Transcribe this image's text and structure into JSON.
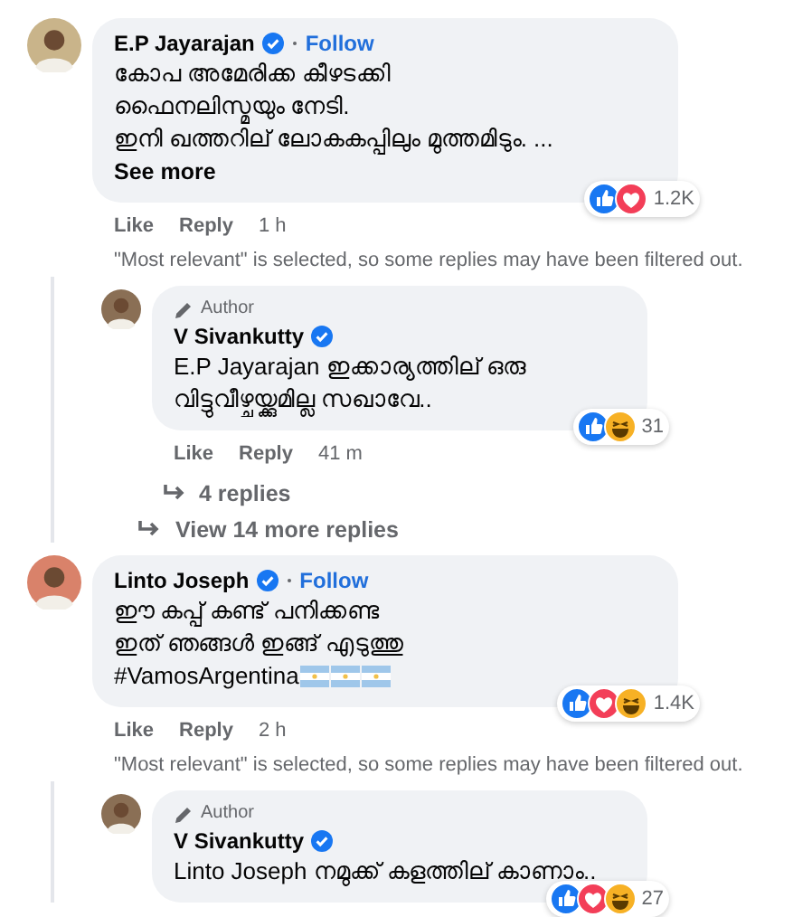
{
  "comments": [
    {
      "author": "E.P Jayarajan",
      "verified": true,
      "follow": "Follow",
      "lines": [
        "കോപ അമേരിക്ക കീഴടക്കി",
        "ഫൈനലിസ്മയും നേടി.",
        "ഇനി ഖത്തറില് ലോകകപ്പിലും മുത്തമിടും. ..."
      ],
      "see_more": "See more",
      "actions": [
        "Like",
        "Reply"
      ],
      "time": "1 h",
      "reactions": [
        {
          "kind": "like"
        },
        {
          "kind": "love"
        }
      ],
      "reaction_count": "1.2K",
      "filter_note": "\"Most relevant\" is selected, so some replies may have been filtered out.",
      "replies": [
        {
          "badge": "Author",
          "author": "V Sivankutty",
          "verified": true,
          "lines": [
            "E.P Jayarajan ഇക്കാര്യത്തില് ഒരു",
            "വിട്ടുവീഴ്ചയ്ക്കുമില്ല സഖാവേ.."
          ],
          "actions": [
            "Like",
            "Reply"
          ],
          "time": "41 m",
          "reactions": [
            {
              "kind": "like"
            },
            {
              "kind": "haha"
            }
          ],
          "reaction_count": "31",
          "sub_replies": "4 replies"
        }
      ],
      "more_replies": "View 14 more replies"
    },
    {
      "author": "Linto Joseph",
      "verified": true,
      "follow": "Follow",
      "lines": [
        "ഈ കപ്പ് കണ്ട് പനിക്കണ്ട",
        "ഇത് ഞങ്ങൾ ഇങ്ങ് എടുത്തു",
        "#VamosArgentina"
      ],
      "flags": [
        {
          "kind": "argentina"
        },
        {
          "kind": "argentina"
        },
        {
          "kind": "argentina"
        }
      ],
      "actions": [
        "Like",
        "Reply"
      ],
      "time": "2 h",
      "reactions": [
        {
          "kind": "like"
        },
        {
          "kind": "love"
        },
        {
          "kind": "haha"
        }
      ],
      "reaction_count": "1.4K",
      "filter_note": "\"Most relevant\" is selected, so some replies may have been filtered out.",
      "replies": [
        {
          "badge": "Author",
          "author": "V Sivankutty",
          "verified": true,
          "lines": [
            "Linto Joseph നമുക്ക് കളത്തില് കാണാം.."
          ],
          "reactions": [
            {
              "kind": "like"
            },
            {
              "kind": "love"
            },
            {
              "kind": "haha"
            }
          ],
          "reaction_count": "27"
        }
      ]
    }
  ]
}
